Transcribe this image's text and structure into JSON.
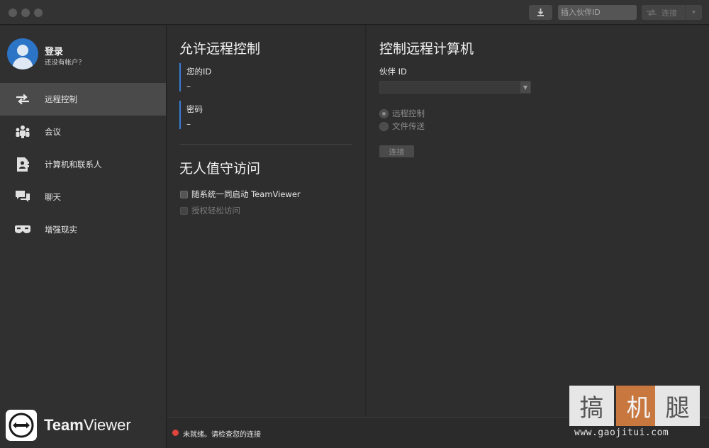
{
  "titlebar": {
    "partner_placeholder": "插入伙伴ID",
    "connect_label": "连接",
    "dropdown_glyph": "▾"
  },
  "sidebar": {
    "login": "登录",
    "no_account": "还没有帐户？",
    "items": [
      {
        "label": "远程控制",
        "icon": "arrows-icon",
        "active": true
      },
      {
        "label": "会议",
        "icon": "meeting-icon",
        "active": false
      },
      {
        "label": "计算机和联系人",
        "icon": "contacts-icon",
        "active": false
      },
      {
        "label": "聊天",
        "icon": "chat-icon",
        "active": false
      },
      {
        "label": "增强现实",
        "icon": "ar-glasses-icon",
        "active": false
      }
    ],
    "brand_bold": "Team",
    "brand_regular": "Viewer"
  },
  "allow_remote": {
    "title": "允许远程控制",
    "your_id_label": "您的ID",
    "your_id_value": "–",
    "password_label": "密码",
    "password_value": "–"
  },
  "unattended": {
    "title": "无人值守访问",
    "start_with_system": "随系统一同启动 TeamViewer",
    "grant_easy_access": "授权轻松访问"
  },
  "control_remote": {
    "title": "控制远程计算机",
    "partner_id_label": "伙伴 ID",
    "partner_id_value": "",
    "option_remote_control": "远程控制",
    "option_file_transfer": "文件传送",
    "connect_button": "连接"
  },
  "status": {
    "text": "未就绪。请检查您的连接",
    "color": "#e0453b"
  },
  "watermark": {
    "chars": [
      "搞",
      "机",
      "腿"
    ],
    "url": "www.gaojitui.com"
  },
  "colors": {
    "accent_blue": "#3c7dd4",
    "avatar_blue": "#2c74c5",
    "watermark_orange": "#c8773f"
  }
}
